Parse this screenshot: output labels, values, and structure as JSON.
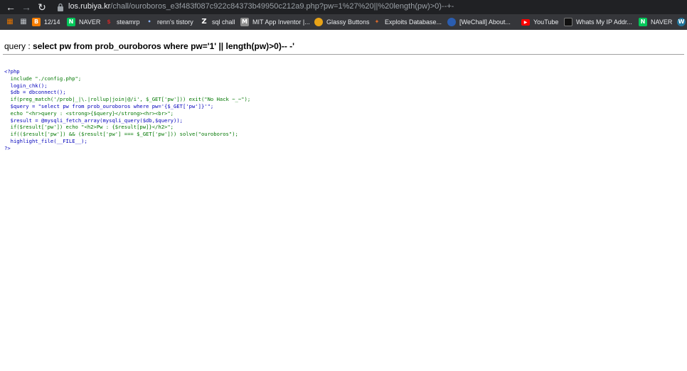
{
  "browser": {
    "url_host": "los.rubiya.kr",
    "url_path": "/chall/ouroboros_e3f483f087c922c84373b49950c212a9.php?pw=1%27%20||%20length(pw)>0)--+-",
    "nav_icons": [
      "back-arrow-icon",
      "forward-arrow-icon",
      "reload-icon",
      "lock-icon"
    ],
    "bookmarks": [
      {
        "label": "",
        "icon": "apps-grid-icon",
        "color": "#e37400"
      },
      {
        "label": "",
        "icon": "bookmark-icon",
        "color": "#5f6368"
      },
      {
        "label": "12/14",
        "icon": "blogger-icon",
        "color": "#f57d00"
      },
      {
        "label": "NAVER",
        "icon": "naver-icon",
        "color": "#03c75a"
      },
      {
        "label": "steamrp",
        "icon": "dollar-icon",
        "color": "#c62828"
      },
      {
        "label": "renn's tistory",
        "icon": "tistory-icon",
        "color": "#4a4a4a"
      },
      {
        "label": "sql chall",
        "icon": "z-icon",
        "color": "#5f6368"
      },
      {
        "label": "MIT App Inventor |...",
        "icon": "mit-icon",
        "color": "#8e8e8e"
      },
      {
        "label": "Glassy Buttons",
        "icon": "glassy-icon",
        "color": "#e8a317"
      },
      {
        "label": "Exploits Database...",
        "icon": "exploitdb-icon",
        "color": "#e06a2b"
      },
      {
        "label": "[WeChall] About...",
        "icon": "wechall-icon",
        "color": "#2a5db0"
      },
      {
        "label": "YouTube",
        "icon": "youtube-icon",
        "color": "#ff0000"
      },
      {
        "label": "Whats My IP Addr...",
        "icon": "ip-icon",
        "color": "#111111"
      },
      {
        "label": "NAVER",
        "icon": "naver-icon",
        "color": "#03c75a"
      },
      {
        "label": "",
        "icon": "wordpress-icon",
        "color": "#21759b"
      }
    ]
  },
  "page": {
    "query_prefix": "query : ",
    "query_sql": "select pw from prob_ouroboros where pw='1' || length(pw)>0)-- -'",
    "code_lines": [
      "<?php",
      "  include \"./config.php\";",
      "  login_chk();",
      "  $db = dbconnect();",
      "  if(preg_match('/prob|_|\\.|rollup|join|@/i', $_GET['pw'])) exit(\"No Hack ~_~\");",
      "  $query = \"select pw from prob_ouroboros where pw='{$_GET['pw']}'\";",
      "  echo \"<hr>query : <strong>{$query}</strong><hr><br>\";",
      "  $result = @mysqli_fetch_array(mysqli_query($db,$query));",
      "  if($result['pw']) echo \"<h2>Pw : {$result[pw]}</h2>\";",
      "  if(($result['pw']) && ($result['pw'] === $_GET['pw'])) solve(\"ouroboros\");",
      "  highlight_file(__FILE__);",
      "?>"
    ]
  }
}
